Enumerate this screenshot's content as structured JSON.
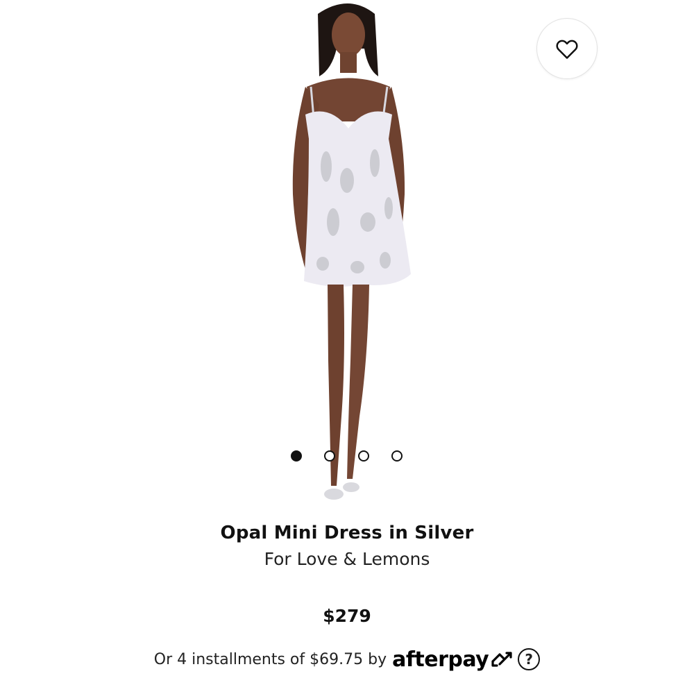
{
  "product": {
    "title": "Opal Mini Dress in Silver",
    "brand": "For Love & Lemons",
    "price": "$279"
  },
  "gallery": {
    "image_alt": "Model wearing Opal Mini Dress in Silver",
    "image_count": 4,
    "active_index": 0
  },
  "payment": {
    "installments_text": "Or 4 installments of $69.75 by",
    "provider": "afterpay",
    "help_label": "?"
  },
  "icons": {
    "wishlist": "heart-icon",
    "afterpay_mark": "afterpay-arrows-icon",
    "help": "question-circle-icon"
  },
  "colors": {
    "text": "#111111",
    "accent": "#000000",
    "background": "#ffffff"
  }
}
